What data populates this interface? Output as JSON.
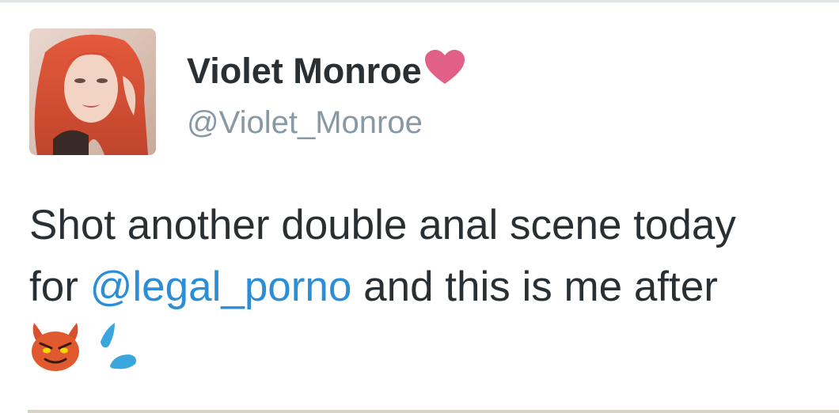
{
  "tweet": {
    "user": {
      "display_name": "Violet Monroe",
      "handle": "@Violet_Monroe",
      "avatar_icon": "profile-photo",
      "name_emoji": "heart-icon"
    },
    "text": {
      "line1": "Shot another double anal scene today",
      "line2_prefix": "for ",
      "mention": "@legal_porno",
      "line2_suffix": " and this is me after"
    },
    "emojis": [
      "imp-icon",
      "sweat-droplets-icon"
    ]
  },
  "colors": {
    "text": "#292f33",
    "secondary": "#8899a6",
    "link": "#2b8ed6",
    "heart": "#e06088"
  }
}
